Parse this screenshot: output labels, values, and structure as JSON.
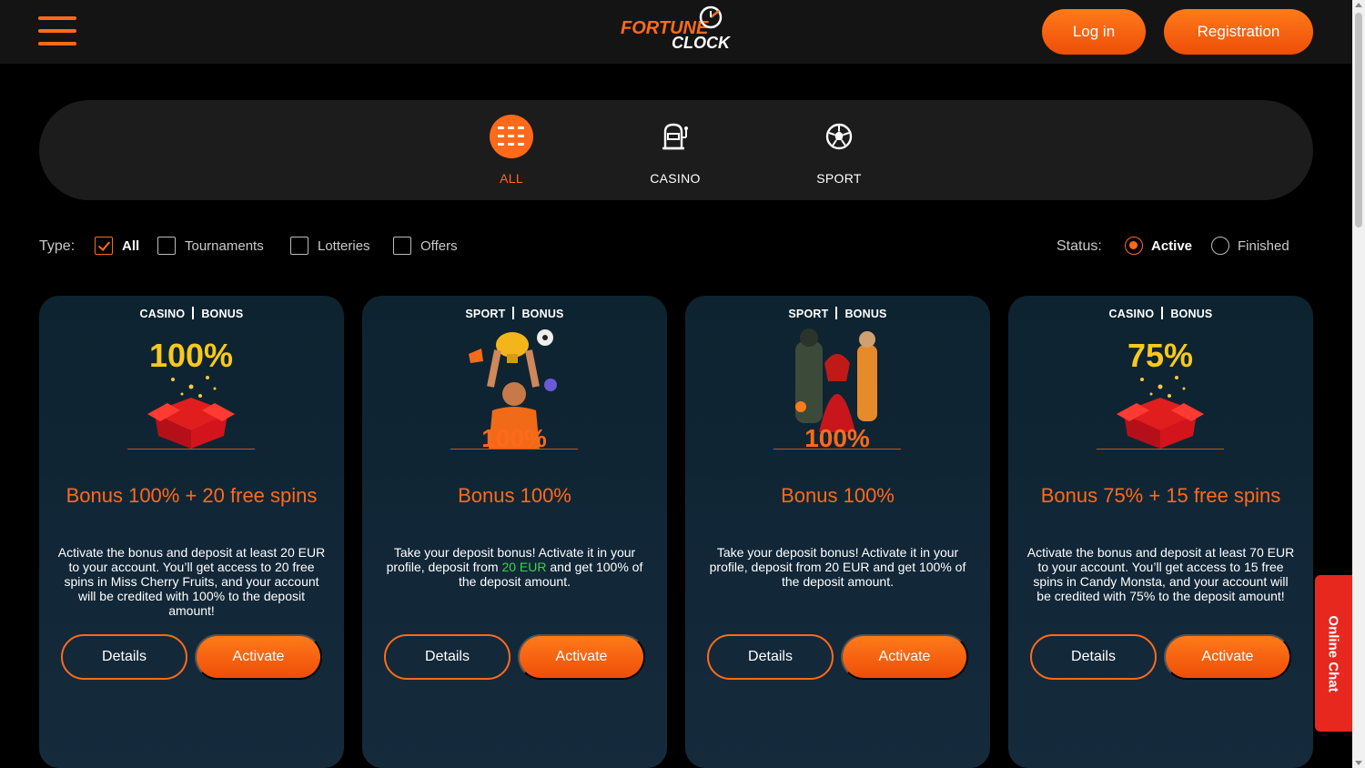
{
  "brand": {
    "line1": "FORTUNE",
    "line2": "CLOCK",
    "accent": "#ff6a1a"
  },
  "header": {
    "menu_icon": "hamburger-icon",
    "login_label": "Log in",
    "register_label": "Registration"
  },
  "categories": [
    {
      "label": "ALL",
      "icon": "grid-icon",
      "active": true
    },
    {
      "label": "CASINO",
      "icon": "slot-machine-icon",
      "active": false
    },
    {
      "label": "SPORT",
      "icon": "soccer-ball-icon",
      "active": false
    }
  ],
  "filters": {
    "type_label": "Type:",
    "types": [
      {
        "label": "All",
        "checked": true
      },
      {
        "label": "Tournaments",
        "checked": false
      },
      {
        "label": "Lotteries",
        "checked": false
      },
      {
        "label": "Offers",
        "checked": false
      }
    ],
    "status_label": "Status:",
    "statuses": [
      {
        "label": "Active",
        "selected": true
      },
      {
        "label": "Finished",
        "selected": false
      }
    ]
  },
  "cards": [
    {
      "tag1": "CASINO",
      "tag2": "BONUS",
      "art_text": "100%",
      "title": "Bonus 100% + 20 free spins",
      "desc_pre": "Activate the bonus and deposit at least 20 EUR to your account. You’ll get access to 20 free spins in Miss Cherry Fruits, and your account will be credited with 100% to the deposit amount!",
      "desc_hl": "",
      "desc_post": "",
      "details": "Details",
      "activate": "Activate"
    },
    {
      "tag1": "SPORT",
      "tag2": "BONUS",
      "art_text": "100%",
      "title": "Bonus 100%",
      "desc_pre": "Take your deposit bonus! Activate it in your profile, deposit from ",
      "desc_hl": "20 EUR",
      "desc_post": " and get 100% of the deposit amount.",
      "details": "Details",
      "activate": "Activate"
    },
    {
      "tag1": "SPORT",
      "tag2": "BONUS",
      "art_text": "100%",
      "title": "Bonus 100%",
      "desc_pre": "Take your deposit bonus! Activate it in your profile, deposit from 20 EUR and get 100% of the deposit amount.",
      "desc_hl": "",
      "desc_post": "",
      "details": "Details",
      "activate": "Activate"
    },
    {
      "tag1": "CASINO",
      "tag2": "BONUS",
      "art_text": "75%",
      "title": "Bonus 75% + 15 free spins",
      "desc_pre": "Activate the bonus and deposit at least 70 EUR to your account. You’ll get access to 15 free spins in Candy Monsta, and your account will be credited with 75% to the deposit amount!",
      "desc_hl": "",
      "desc_post": "",
      "details": "Details",
      "activate": "Activate"
    }
  ],
  "chat": {
    "label": "Online Chat"
  }
}
